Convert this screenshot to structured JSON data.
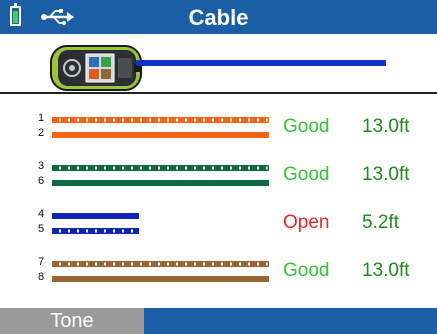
{
  "header": {
    "title": "Cable",
    "battery_icon": "battery-icon",
    "usb_icon": "usb-icon",
    "bar_color": "#1a5ea6"
  },
  "device": {
    "icon": "cable-tester-device-icon",
    "cable_color": "#1033c9"
  },
  "pairs": [
    {
      "pin_a": "1",
      "pin_b": "2",
      "color": "#f26418",
      "stripe_pin": "a",
      "status": "Good",
      "status_color": "#35c435",
      "length": "13.0ft",
      "wire_fraction": 1.0
    },
    {
      "pin_a": "3",
      "pin_b": "6",
      "color": "#0f6b45",
      "stripe_pin": "a",
      "status": "Good",
      "status_color": "#35c435",
      "length": "13.0ft",
      "wire_fraction": 1.0
    },
    {
      "pin_a": "4",
      "pin_b": "5",
      "color": "#1224b4",
      "stripe_pin": "b",
      "status": "Open",
      "status_color": "#e8262a",
      "length": "5.2ft",
      "wire_fraction": 0.4
    },
    {
      "pin_a": "7",
      "pin_b": "8",
      "color": "#9a6435",
      "stripe_pin": "a",
      "status": "Good",
      "status_color": "#35c435",
      "length": "13.0ft",
      "wire_fraction": 1.0
    }
  ],
  "footer": {
    "tone_label": "Tone"
  }
}
